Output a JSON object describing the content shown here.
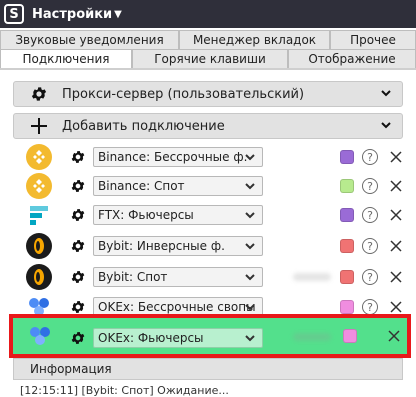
{
  "window": {
    "title": "Настройки"
  },
  "tabs_top": [
    "Звуковые уведомления",
    "Менеджер вкладок",
    "Прочее"
  ],
  "tabs_bottom": [
    "Подключения",
    "Горячие клавиши",
    "Отображение"
  ],
  "active_tab": "Подключения",
  "proxy_section": {
    "label": "Прокси-сервер (пользовательский)",
    "icon": "gear-icon"
  },
  "add_connection": {
    "label": "Добавить подключение",
    "icon": "plus-icon"
  },
  "connections": [
    {
      "logo": "binance-logo-icon",
      "value": "Binance: Бессрочные ф.",
      "color": "#9a6bd6"
    },
    {
      "logo": "binance-logo-icon",
      "value": "Binance: Спот",
      "color": "#b7ea8e"
    },
    {
      "logo": "ftx-logo-icon",
      "value": "FTX: Фьючерсы",
      "color": "#9a6bd6"
    },
    {
      "logo": "bybit-logo-icon",
      "value": "Bybit: Инверсные ф.",
      "color": "#f07373"
    },
    {
      "logo": "bybit-logo-icon",
      "value": "Bybit: Спот",
      "color": "#f07373"
    },
    {
      "logo": "okex-logo-icon",
      "value": "OKEx: Бессрочные свопы",
      "color": "#f08de0"
    },
    {
      "logo": "okex-logo-icon",
      "value": "OKEx: Фьючерсы",
      "color": "#f08de0",
      "highlighted": true
    }
  ],
  "info": {
    "label": "Информация",
    "log": "[12:15:11] [Bybit: Спот] Ожидание..."
  },
  "colors": {
    "titlebar": "#2f2f3a",
    "highlight_border": "#e8181a",
    "highlight_fill": "#53e08c"
  }
}
